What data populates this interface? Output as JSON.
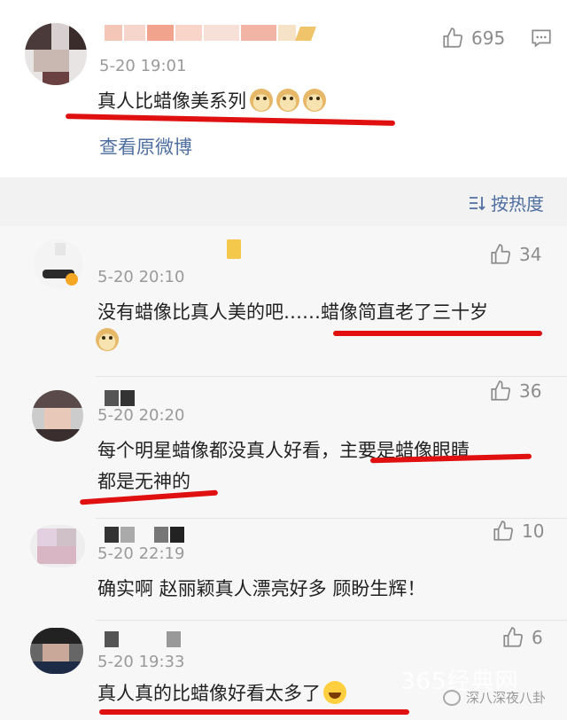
{
  "post": {
    "timestamp": "5-20 19:01",
    "text": "真人比蜡像美系列",
    "emojis": [
      "doge-emoji",
      "doge-emoji",
      "doge-emoji"
    ],
    "like_count": "695",
    "view_original_label": "查看原微博"
  },
  "sort": {
    "label": "按热度"
  },
  "comments": [
    {
      "timestamp": "5-20 20:10",
      "text": "没有蜡像比真人美的吧……蜡像简直老了三十岁",
      "likes": "34",
      "emoji": "doge-emoji"
    },
    {
      "timestamp": "5-20 20:20",
      "text_line1": "每个明星蜡像都没真人好看，主要是蜡像眼睛",
      "text_line2": "都是无神的",
      "likes": "36"
    },
    {
      "timestamp": "5-20 22:19",
      "text": "确实啊 赵丽颖真人漂亮好多 顾盼生辉！",
      "likes": "10"
    },
    {
      "timestamp": "5-20 19:33",
      "text": "真人真的比蜡像好看太多了",
      "likes": "6",
      "emoji": "laughing-tears-emoji"
    }
  ],
  "watermark": {
    "site": "365经典网",
    "account": "深八深夜八卦"
  },
  "colors": {
    "highlight_red": "#e01010",
    "link_blue": "#4f6fa0",
    "muted_gray": "#9a9a9a"
  }
}
